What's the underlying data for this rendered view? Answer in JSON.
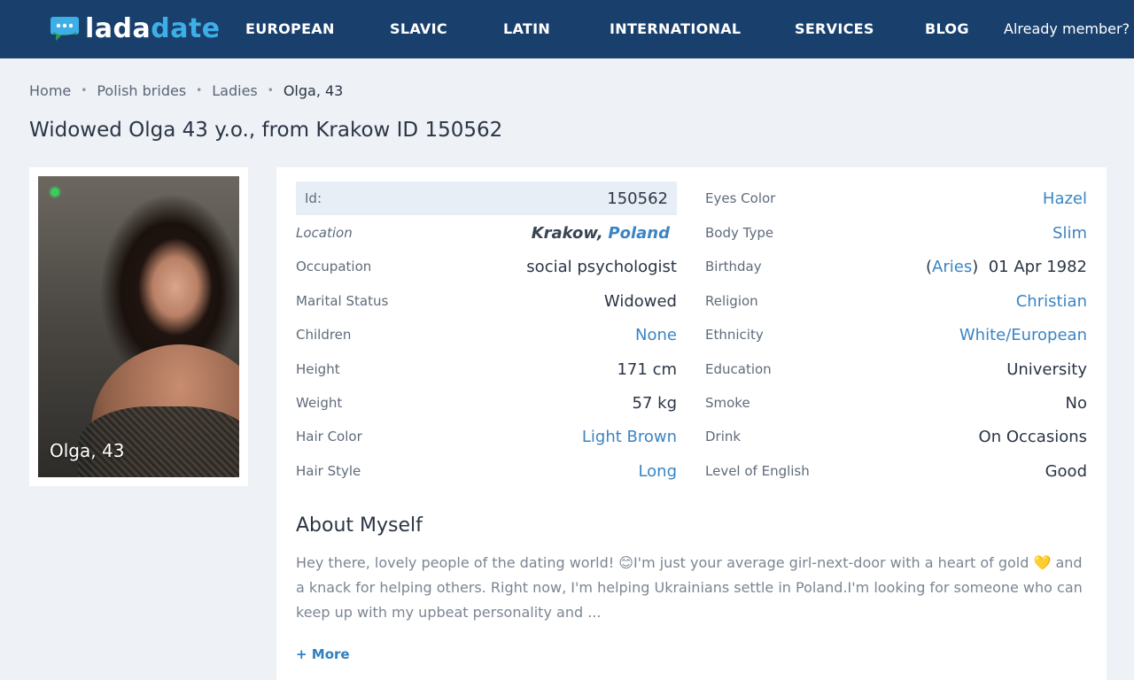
{
  "header": {
    "logo": {
      "part1": "lada",
      "part2": "date"
    },
    "nav": [
      "EUROPEAN",
      "SLAVIC",
      "LATIN",
      "INTERNATIONAL",
      "SERVICES",
      "BLOG"
    ],
    "member_link": "Already member?"
  },
  "breadcrumb": {
    "home": "Home",
    "category": "Polish brides",
    "section": "Ladies",
    "current": "Olga, 43"
  },
  "page_title": "Widowed Olga 43 y.o., from Krakow ID 150562",
  "photo": {
    "caption": "Olga, 43",
    "online": true,
    "online_color": "#3bcb5f"
  },
  "profile_left": {
    "id": {
      "label": "Id:",
      "value": "150562"
    },
    "location": {
      "label": "Location",
      "city": "Krakow,",
      "country": "Poland"
    },
    "occupation": {
      "label": "Occupation",
      "value": "social psychologist"
    },
    "marital": {
      "label": "Marital Status",
      "value": "Widowed"
    },
    "children": {
      "label": "Children",
      "value": "None"
    },
    "height": {
      "label": "Height",
      "value": "171 cm"
    },
    "weight": {
      "label": "Weight",
      "value": "57 kg"
    },
    "hair_color": {
      "label": "Hair Color",
      "value": "Light Brown"
    },
    "hair_style": {
      "label": "Hair Style",
      "value": "Long"
    }
  },
  "profile_right": {
    "eyes": {
      "label": "Eyes Color",
      "value": "Hazel"
    },
    "body": {
      "label": "Body Type",
      "value": "Slim"
    },
    "birthday": {
      "label": "Birthday",
      "paren_open": "(",
      "zodiac": "Aries",
      "paren_close": ")",
      "date": "01 Apr 1982"
    },
    "religion": {
      "label": "Religion",
      "value": "Christian"
    },
    "ethnicity": {
      "label": "Ethnicity",
      "value": "White/European"
    },
    "education": {
      "label": "Education",
      "value": "University"
    },
    "smoke": {
      "label": "Smoke",
      "value": "No"
    },
    "drink": {
      "label": "Drink",
      "value": "On Occasions"
    },
    "english": {
      "label": "Level of English",
      "value": "Good"
    }
  },
  "about": {
    "title": "About Myself",
    "text": "Hey there, lovely people of the dating world! 😊I'm just your average girl-next-door with a heart of gold 💛 and a knack for helping others. Right now, I'm helping Ukrainians settle in Poland.I'm looking for someone who can keep up with my upbeat personality and ...",
    "more": "+ More"
  },
  "colors": {
    "header_bg": "#19406d",
    "accent": "#3eaee7",
    "link": "#3b84c4",
    "page_bg": "#eef1f6"
  }
}
